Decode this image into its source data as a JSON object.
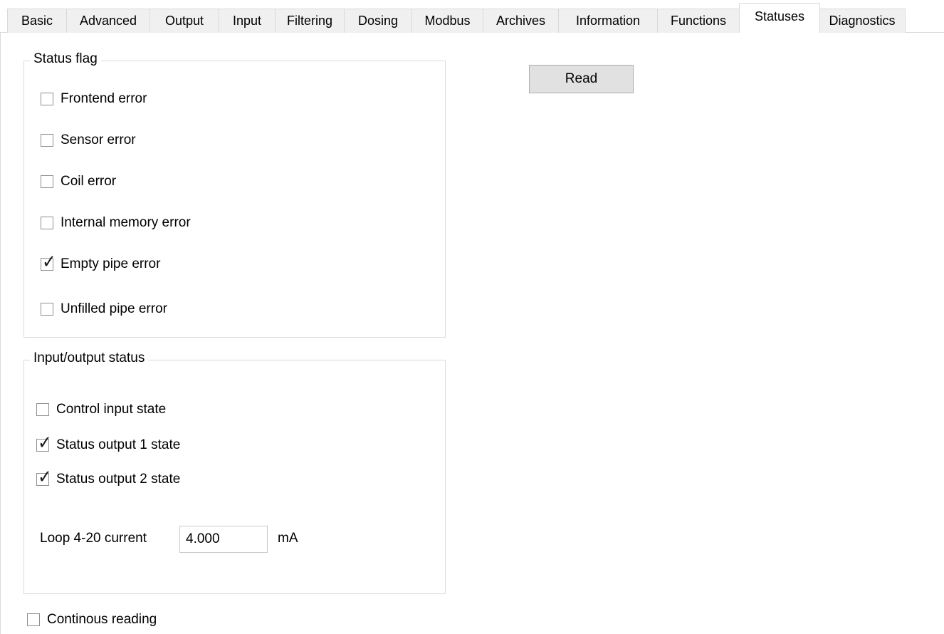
{
  "tabs": [
    {
      "label": "Basic",
      "active": false
    },
    {
      "label": "Advanced",
      "active": false
    },
    {
      "label": "Output",
      "active": false
    },
    {
      "label": "Input",
      "active": false
    },
    {
      "label": "Filtering",
      "active": false
    },
    {
      "label": "Dosing",
      "active": false
    },
    {
      "label": "Modbus",
      "active": false
    },
    {
      "label": "Archives",
      "active": false
    },
    {
      "label": "Information",
      "active": false
    },
    {
      "label": "Functions",
      "active": false
    },
    {
      "label": "Statuses",
      "active": true
    },
    {
      "label": "Diagnostics",
      "active": false
    }
  ],
  "status_flag": {
    "title": "Status flag",
    "items": [
      {
        "label": "Frontend error",
        "checked": false
      },
      {
        "label": "Sensor error",
        "checked": false
      },
      {
        "label": "Coil error",
        "checked": false
      },
      {
        "label": "Internal memory error",
        "checked": false
      },
      {
        "label": "Empty pipe error",
        "checked": true
      },
      {
        "label": "Unfilled pipe error",
        "checked": false
      }
    ]
  },
  "read_button": {
    "label": "Read"
  },
  "io_status": {
    "title": "Input/output status",
    "items": [
      {
        "label": "Control input state",
        "checked": false
      },
      {
        "label": "Status output 1 state",
        "checked": true
      },
      {
        "label": "Status output 2 state",
        "checked": true
      }
    ],
    "loop_label": "Loop 4-20 current",
    "loop_value": "4.000",
    "loop_unit": "mA"
  },
  "continuous_reading": {
    "label": "Continous reading",
    "checked": false
  }
}
